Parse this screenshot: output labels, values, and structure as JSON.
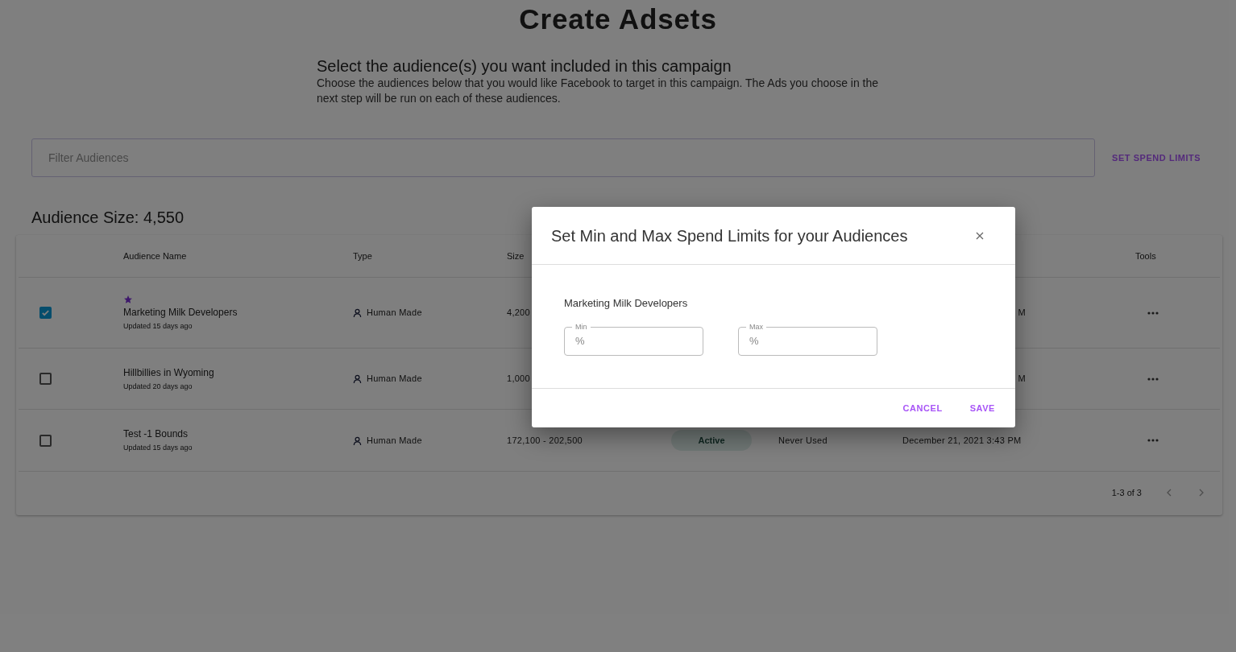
{
  "page": {
    "title": "Create Adsets",
    "subtitle": "Select the audience(s) you want included in this campaign",
    "description": "Choose the audiences below that you would like Facebook to target in this campaign. The Ads you choose in the next step will be run on each of these audiences."
  },
  "filter": {
    "placeholder": "Filter Audiences"
  },
  "spend_limits_button": "SET SPEND LIMITS",
  "audience_size": "Audience Size: 4,550",
  "table": {
    "headers": {
      "name": "Audience Name",
      "type": "Type",
      "size": "Size",
      "tools": "Tools"
    },
    "rows": [
      {
        "selected": true,
        "starred": true,
        "name": "Marketing Milk Developers",
        "updated": "Updated 15 days ago",
        "type": "Human Made",
        "size": "4,200",
        "date": "M"
      },
      {
        "selected": false,
        "starred": false,
        "name": "Hillbillies in Wyoming",
        "updated": "Updated 20 days ago",
        "type": "Human Made",
        "size": "1,000",
        "date": "M"
      },
      {
        "selected": false,
        "starred": false,
        "name": "Test -1 Bounds",
        "updated": "Updated 15 days ago",
        "type": "Human Made",
        "size": "172,100 - 202,500",
        "status": "Active",
        "usage": "Never Used",
        "date": "December 21, 2021 3:43 PM"
      }
    ],
    "pagination": "1-3 of 3"
  },
  "dialog": {
    "title": "Set Min and Max Spend Limits for your Audiences",
    "audience": "Marketing Milk Developers",
    "fields": [
      {
        "label": "Min",
        "adornment": "%"
      },
      {
        "label": "Max",
        "adornment": "%"
      }
    ],
    "buttons": [
      "CANCEL",
      "SAVE"
    ]
  }
}
